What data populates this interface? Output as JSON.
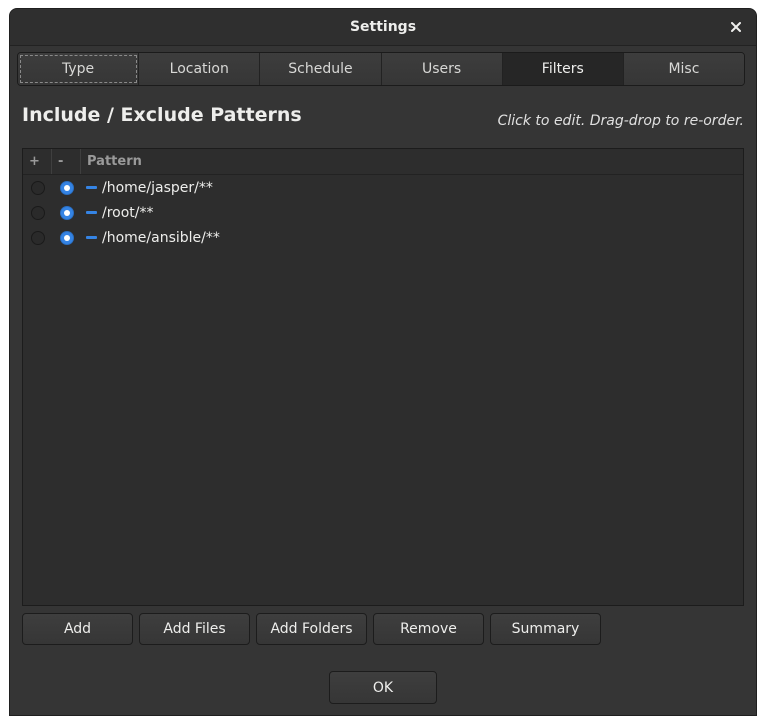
{
  "window": {
    "title": "Settings"
  },
  "tabs": [
    {
      "label": "Type"
    },
    {
      "label": "Location"
    },
    {
      "label": "Schedule"
    },
    {
      "label": "Users"
    },
    {
      "label": "Filters"
    },
    {
      "label": "Misc"
    }
  ],
  "active_tab": "Filters",
  "section": {
    "title": "Include / Exclude Patterns",
    "hint": "Click to edit. Drag-drop to re-order."
  },
  "list": {
    "headers": {
      "include": "+",
      "exclude": "-",
      "pattern": "Pattern"
    },
    "rows": [
      {
        "pattern": "/home/jasper/**",
        "mode": "exclude"
      },
      {
        "pattern": "/root/**",
        "mode": "exclude"
      },
      {
        "pattern": "/home/ansible/**",
        "mode": "exclude"
      }
    ]
  },
  "buttons": {
    "add": "Add",
    "add_files": "Add Files",
    "add_folders": "Add Folders",
    "remove": "Remove",
    "summary": "Summary",
    "ok": "OK"
  },
  "colors": {
    "accent": "#3584e4",
    "background": "#353535"
  }
}
